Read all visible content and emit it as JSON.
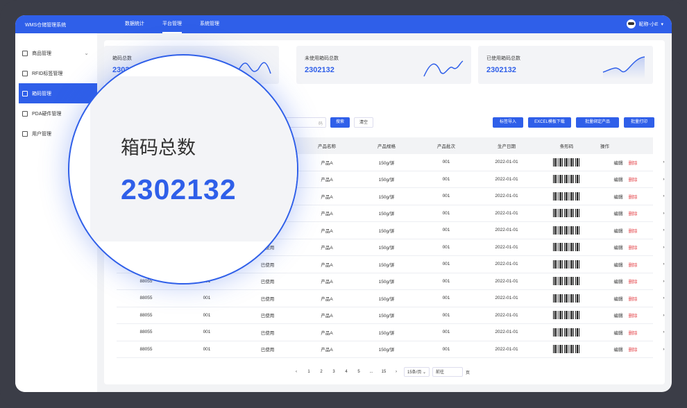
{
  "app": {
    "title": "WMS仓储管理系统"
  },
  "topnav": {
    "items": [
      "数据统计",
      "平台管理",
      "系统管理"
    ],
    "active": "平台管理"
  },
  "user": {
    "name": "昵称-小E"
  },
  "sidebar": {
    "items": [
      {
        "label": "商品管理",
        "icon": "package-icon",
        "expandable": true
      },
      {
        "label": "RFID标签管理",
        "icon": "rfid-icon"
      },
      {
        "label": "箱码管理",
        "icon": "scan-icon",
        "active": true
      },
      {
        "label": "PDA硬件管理",
        "icon": "device-icon"
      },
      {
        "label": "用户管理",
        "icon": "user-icon"
      }
    ]
  },
  "cards": [
    {
      "label": "箱码总数",
      "value": "2302132"
    },
    {
      "label": "未使用箱码总数",
      "value": "2302132"
    },
    {
      "label": "已使用箱码总数",
      "value": "2302132"
    }
  ],
  "zoom": {
    "label": "箱码总数",
    "value": "2302132"
  },
  "filters": {
    "search_button": "搜索",
    "clear_button": "清空",
    "partial_placeholder": "码"
  },
  "toolbar": {
    "import": "标签导入",
    "excel": "EXCEL模板下载",
    "bind": "批量绑定产品",
    "print": "批量打印"
  },
  "table": {
    "columns": [
      "",
      "",
      "",
      "产品名称",
      "产品规格",
      "产品批次",
      "生产日期",
      "条形码",
      "操作"
    ],
    "rows": [
      [
        "",
        "",
        "",
        "产品A",
        "150g/饼",
        "001",
        "2022-01-01"
      ],
      [
        "",
        "",
        "",
        "产品A",
        "150g/饼",
        "001",
        "2022-01-01"
      ],
      [
        "",
        "",
        "",
        "产品A",
        "150g/饼",
        "001",
        "2022-01-01"
      ],
      [
        "",
        "",
        "已使用",
        "产品A",
        "150g/饼",
        "001",
        "2022-01-01"
      ],
      [
        "",
        "",
        "已使用",
        "产品A",
        "150g/饼",
        "001",
        "2022-01-01"
      ],
      [
        "",
        "",
        "已使用",
        "产品A",
        "150g/饼",
        "001",
        "2022-01-01"
      ],
      [
        "",
        "001",
        "已使用",
        "产品A",
        "150g/饼",
        "001",
        "2022-01-01"
      ],
      [
        "88055",
        "001",
        "已使用",
        "产品A",
        "150g/饼",
        "001",
        "2022-01-01"
      ],
      [
        "88055",
        "001",
        "已使用",
        "产品A",
        "150g/饼",
        "001",
        "2022-01-01"
      ],
      [
        "88055",
        "001",
        "已使用",
        "产品A",
        "150g/饼",
        "001",
        "2022-01-01"
      ],
      [
        "88055",
        "001",
        "已使用",
        "产品A",
        "150g/饼",
        "001",
        "2022-01-01"
      ],
      [
        "88055",
        "001",
        "已使用",
        "产品A",
        "150g/饼",
        "001",
        "2022-01-01"
      ]
    ],
    "edit_label": "编辑",
    "delete_label": "删除"
  },
  "pagination": {
    "pages": [
      "1",
      "2",
      "3",
      "4",
      "5",
      "...",
      "15"
    ],
    "page_size": "15条/页",
    "jump_label": "前往",
    "page_suffix": "页"
  }
}
